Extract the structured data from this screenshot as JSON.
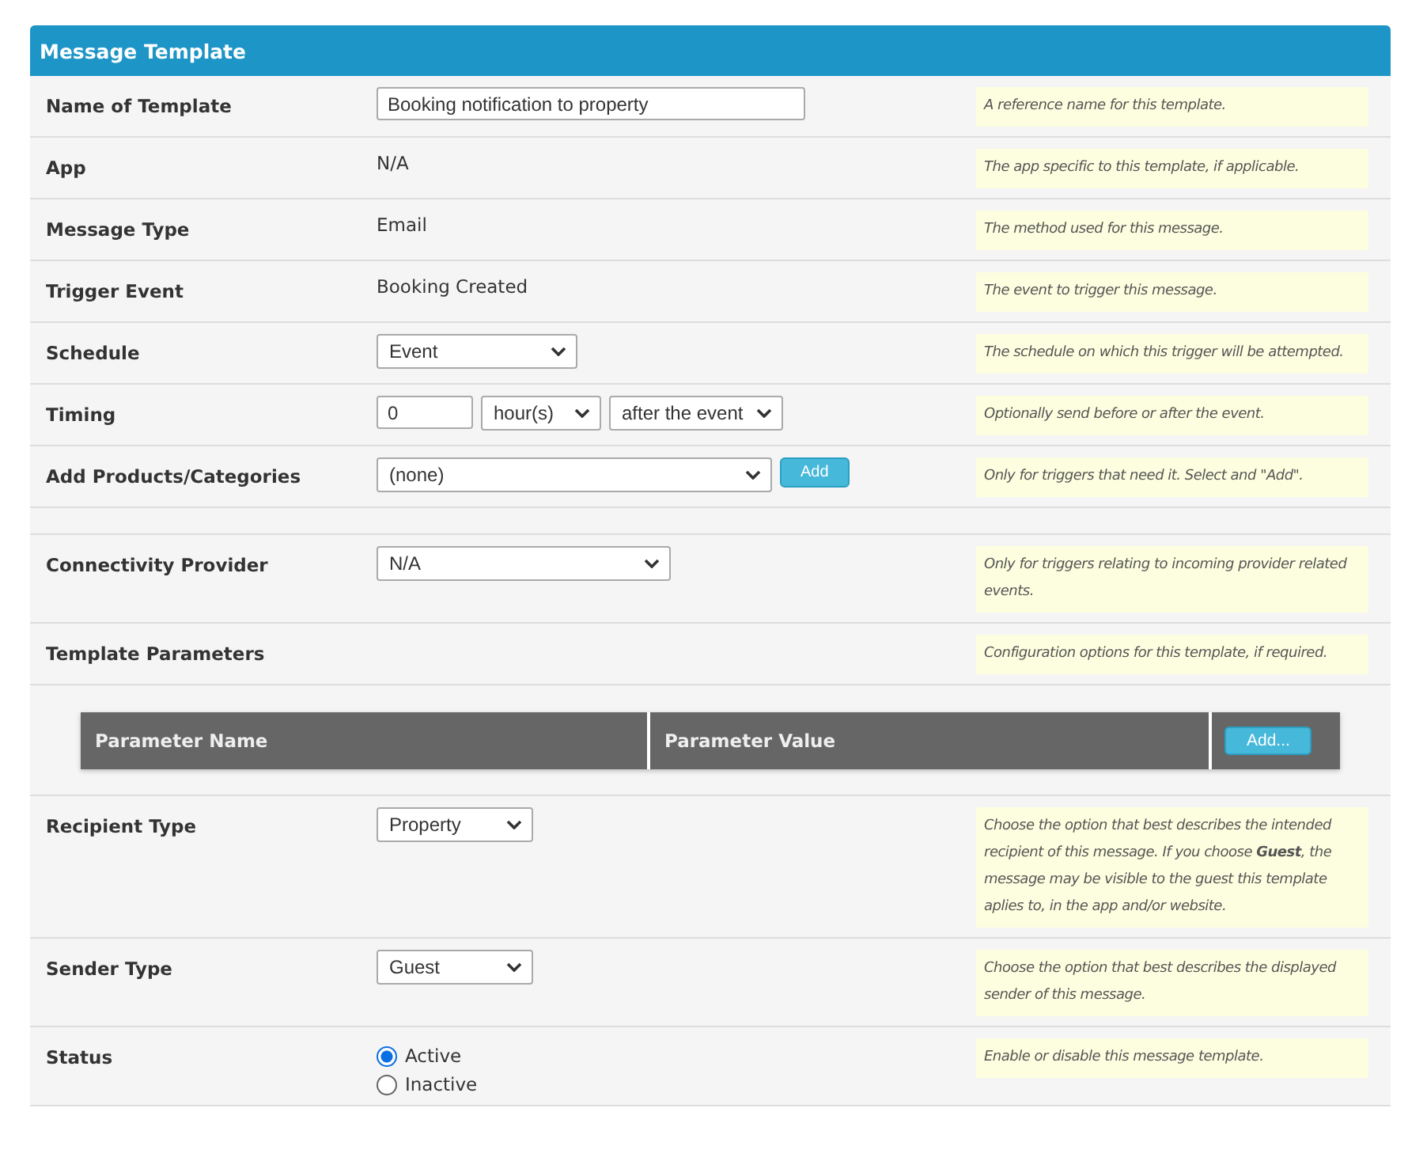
{
  "panel": {
    "title": "Message Template"
  },
  "rows": [
    {
      "kind": "field",
      "label": "Name of Template",
      "controls": [
        {
          "kind": "input",
          "value": "Booking notification to property"
        }
      ],
      "help": "A reference name for this template."
    },
    {
      "kind": "field",
      "label": "App",
      "controls": [
        {
          "kind": "text",
          "value": "N/A"
        }
      ],
      "help": "The app specific to this template, if applicable."
    },
    {
      "kind": "field",
      "label": "Message Type",
      "controls": [
        {
          "kind": "text",
          "value": "Email"
        }
      ],
      "help": "The method used for this message."
    },
    {
      "kind": "field",
      "label": "Trigger Event",
      "controls": [
        {
          "kind": "text",
          "value": "Booking Created"
        }
      ],
      "help": "The event to trigger this message."
    },
    {
      "kind": "field",
      "label": "Schedule",
      "controls": [
        {
          "kind": "select",
          "value": "Event"
        }
      ],
      "help": "The schedule on which this trigger will be attempted."
    },
    {
      "kind": "field",
      "label": "Timing",
      "controls": [
        {
          "kind": "input",
          "value": "0"
        },
        {
          "kind": "select",
          "value": "hour(s)"
        },
        {
          "kind": "select",
          "value": "after the event"
        }
      ],
      "help": "Optionally send before or after the event."
    },
    {
      "kind": "field",
      "label": "Add Products/Categories",
      "controls": [
        {
          "kind": "select",
          "value": "(none)"
        },
        {
          "kind": "button",
          "value": "Add"
        }
      ],
      "help": "Only for triggers that need it. Select and \"Add\"."
    },
    {
      "kind": "spacer"
    },
    {
      "kind": "field",
      "label": "Connectivity Provider",
      "controls": [
        {
          "kind": "select",
          "value": "N/A"
        }
      ],
      "help": "Only for triggers relating to incoming provider related events."
    },
    {
      "kind": "field",
      "label": "Template Parameters",
      "help": "Configuration options for this template, if required."
    },
    {
      "kind": "table",
      "columns": [
        "Parameter Name",
        "Parameter Value"
      ],
      "button": "Add..."
    },
    {
      "kind": "field",
      "label": "Recipient Type",
      "controls": [
        {
          "kind": "select",
          "value": "Property"
        }
      ],
      "help": "Choose the option that best describes the intended recipient of this message. If you choose **Guest**, the message may be visible to the guest this template aplies to, in the app and/or website."
    },
    {
      "kind": "field",
      "label": "Sender Type",
      "controls": [
        {
          "kind": "select",
          "value": "Guest"
        }
      ],
      "help": "Choose the option that best describes the displayed sender of this message."
    },
    {
      "kind": "field",
      "label": "Status",
      "controls": [
        {
          "kind": "radios",
          "options": [
            {
              "label": "Active",
              "selected": true
            },
            {
              "label": "Inactive",
              "selected": false
            }
          ]
        }
      ],
      "help": "Enable or disable this message template."
    }
  ]
}
